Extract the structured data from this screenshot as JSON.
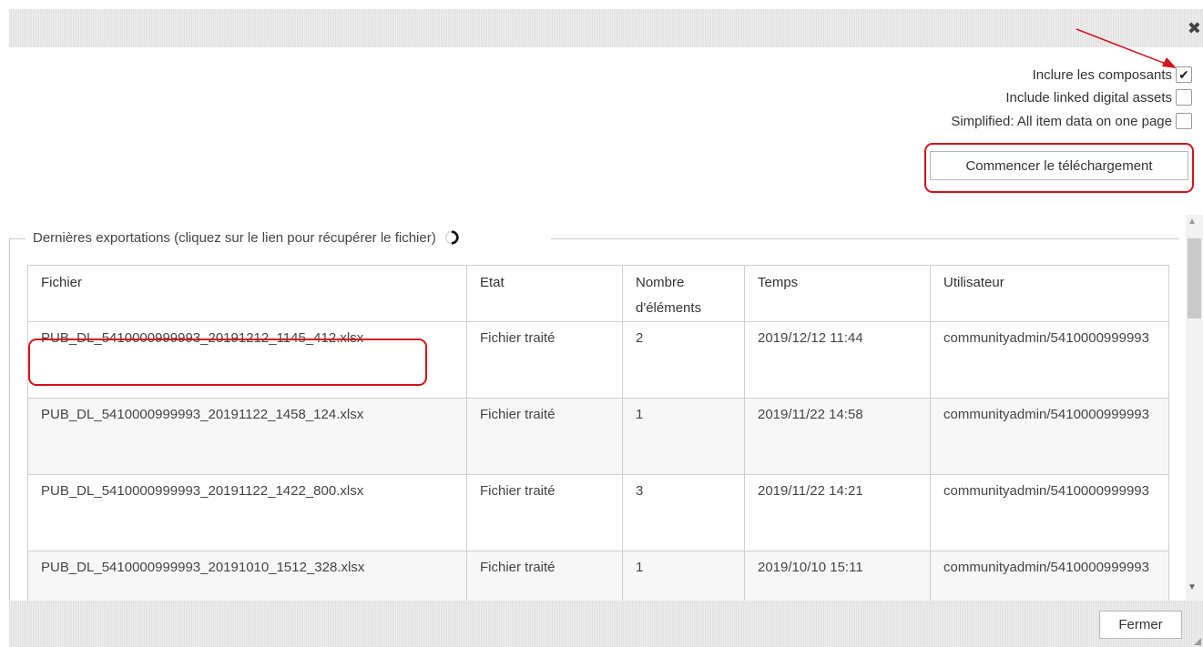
{
  "dialog": {
    "close_icon": "close-icon"
  },
  "options": [
    {
      "label": "Inclure les composants",
      "checked": true
    },
    {
      "label": "Include linked digital assets",
      "checked": false
    },
    {
      "label": "Simplified: All item data on one page",
      "checked": false
    }
  ],
  "start_button": "Commencer le téléchargement",
  "exports": {
    "legend": "Dernières exportations (cliquez sur le lien pour récupérer le fichier)",
    "columns": [
      "Fichier",
      "Etat",
      "Nombre d'éléments",
      "Temps",
      "Utilisateur"
    ],
    "rows": [
      {
        "file": "PUB_DL_5410000999993_20191212_1145_412.xlsx",
        "state": "Fichier traité",
        "count": "2",
        "time": "2019/12/12 11:44",
        "user": "communityadmin/5410000999993"
      },
      {
        "file": "PUB_DL_5410000999993_20191122_1458_124.xlsx",
        "state": "Fichier traité",
        "count": "1",
        "time": "2019/11/22 14:58",
        "user": "communityadmin/5410000999993"
      },
      {
        "file": "PUB_DL_5410000999993_20191122_1422_800.xlsx",
        "state": "Fichier traité",
        "count": "3",
        "time": "2019/11/22 14:21",
        "user": "communityadmin/5410000999993"
      },
      {
        "file": "PUB_DL_5410000999993_20191010_1512_328.xlsx",
        "state": "Fichier traité",
        "count": "1",
        "time": "2019/10/10 15:11",
        "user": "communityadmin/5410000999993"
      }
    ]
  },
  "close_button": "Fermer",
  "colors": {
    "highlight": "#d3141b"
  }
}
